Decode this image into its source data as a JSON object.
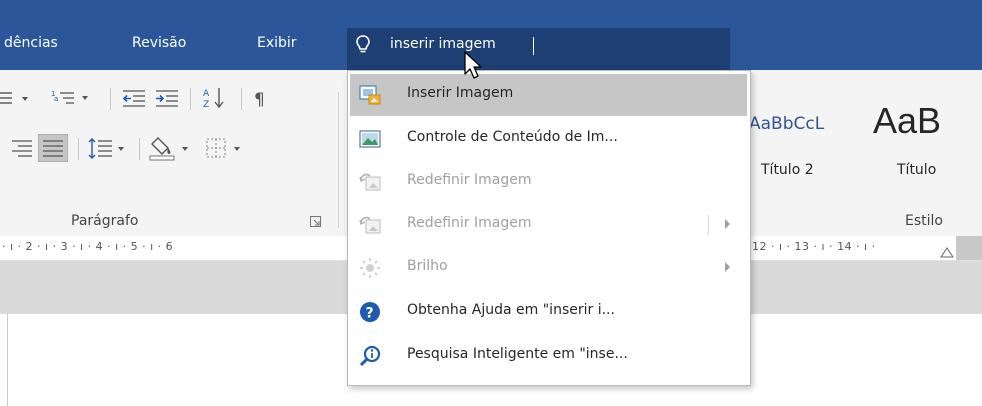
{
  "tabs": {
    "references": "dências",
    "review": "Revisão",
    "view": "Exibir"
  },
  "tell_me": {
    "query": "inserir imagem",
    "icon": "lightbulb-icon"
  },
  "ribbon": {
    "paragraph_group": "Parágrafo",
    "styles_group": "Estilo",
    "styles": [
      {
        "preview": "AaBbCcL",
        "name": "Título 2"
      },
      {
        "preview": "AaB",
        "name": "Título"
      }
    ],
    "accent_color": "#2b579a"
  },
  "ruler": {
    "scale_left": "· ı · 2 · ı · 3 · ı · 4 · ı · 5 · ı · 6",
    "scale_right": "12 · ı · 13 · ı · 14 · ı ·"
  },
  "dropdown": {
    "items": [
      {
        "label": "Inserir Imagem",
        "icon": "insert-picture-icon",
        "state": "hover"
      },
      {
        "label": "Controle de Conteúdo de Im...",
        "icon": "picture-content-control-icon",
        "state": "enabled"
      },
      {
        "label": "Redefinir Imagem",
        "icon": "reset-picture-icon",
        "state": "disabled"
      },
      {
        "label": "Redefinir Imagem",
        "icon": "reset-picture-icon",
        "state": "disabled",
        "submenu": true
      },
      {
        "label": "Brilho",
        "icon": "brightness-icon",
        "state": "disabled",
        "submenu": true
      },
      {
        "label": "Obtenha Ajuda em \"inserir i...",
        "icon": "help-icon",
        "state": "enabled"
      },
      {
        "label": "Pesquisa Inteligente em \"inse...",
        "icon": "smart-lookup-icon",
        "state": "enabled"
      }
    ]
  }
}
